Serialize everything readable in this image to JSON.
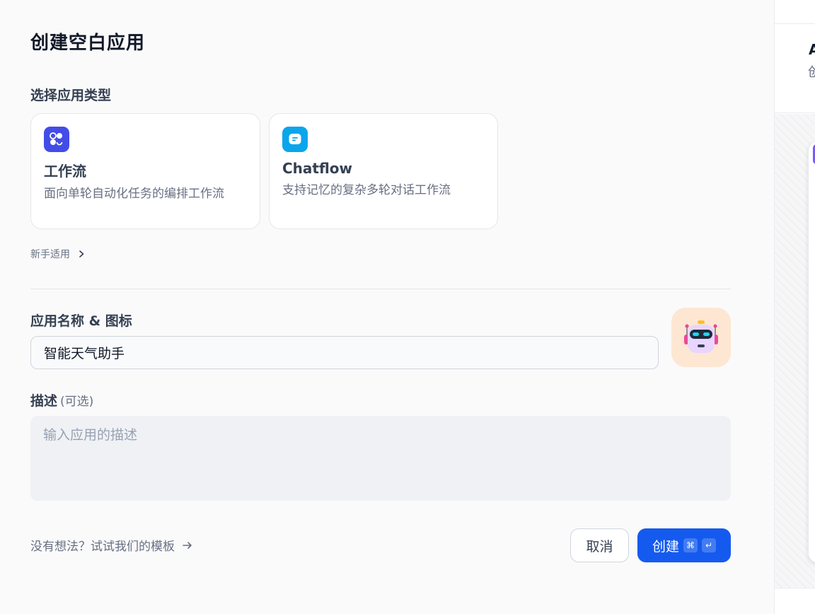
{
  "dialog": {
    "title": "创建空白应用",
    "type_section_label": "选择应用类型",
    "app_types": [
      {
        "title": "工作流",
        "description": "面向单轮自动化任务的编排工作流",
        "icon": "workflow-icon",
        "color": "#444ce7"
      },
      {
        "title": "Chatflow",
        "description": "支持记忆的复杂多轮对话工作流",
        "icon": "chatflow-icon",
        "color": "#0ba5ec"
      }
    ],
    "beginner_label": "新手适用",
    "name_section_label": "应用名称 & 图标",
    "name_value": "智能天气助手",
    "app_icon": "robot-icon",
    "description_label": "描述",
    "description_optional": "(可选)",
    "description_placeholder": "输入应用的描述",
    "template_link": "没有想法？试试我们的模板",
    "cancel_label": "取消",
    "create_label": "创建",
    "create_shortcut": [
      "⌘",
      "↵"
    ],
    "accent_color": "#155aef"
  },
  "side_panel": {
    "title_fragment": "A",
    "subtitle_fragment": "创"
  }
}
